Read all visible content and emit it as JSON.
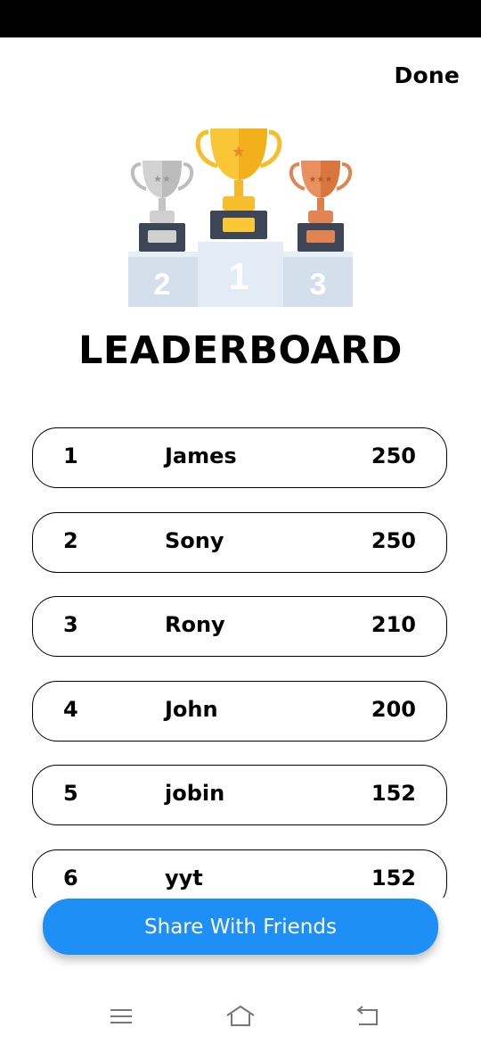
{
  "header": {
    "done_label": "Done"
  },
  "podium": {
    "first": "1",
    "second": "2",
    "third": "3"
  },
  "title": "LEADERBOARD",
  "leaderboard": [
    {
      "rank": "1",
      "name": "James",
      "score": "250"
    },
    {
      "rank": "2",
      "name": "Sony",
      "score": "250"
    },
    {
      "rank": "3",
      "name": "Rony",
      "score": "210"
    },
    {
      "rank": "4",
      "name": "John",
      "score": "200"
    },
    {
      "rank": "5",
      "name": "jobin",
      "score": "152"
    },
    {
      "rank": "6",
      "name": "yyt",
      "score": "152"
    }
  ],
  "share_button_label": "Share With Friends",
  "navigation": {
    "icons": [
      "menu-icon",
      "home-icon",
      "back-icon"
    ]
  },
  "colors": {
    "accent": "#1d8ff5",
    "gold": "#f7be2c",
    "silver": "#c9c9c9",
    "bronze": "#e18451",
    "podium": "#dde7f1"
  }
}
